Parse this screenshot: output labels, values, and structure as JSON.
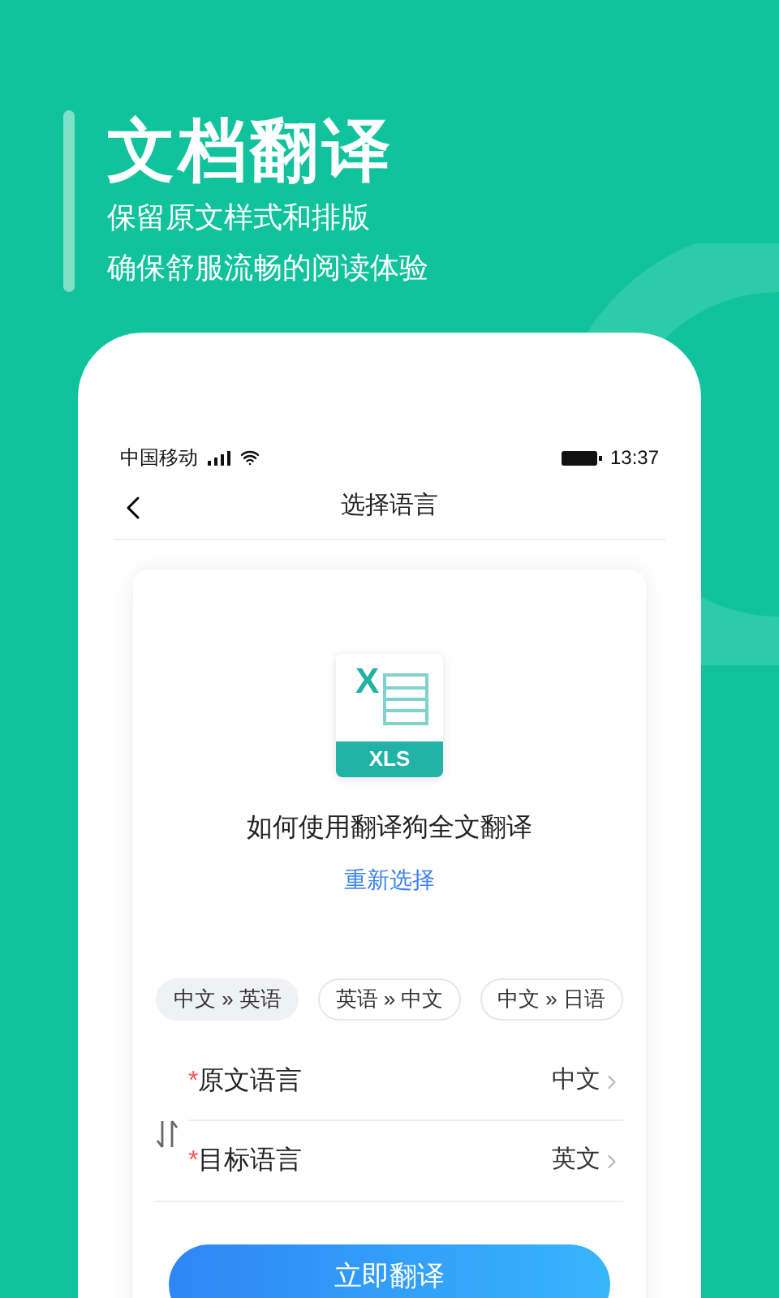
{
  "promo": {
    "title": "文档翻译",
    "lines": [
      "保留原文样式和排版",
      "确保舒服流畅的阅读体验"
    ]
  },
  "status_bar": {
    "carrier": "中国移动",
    "time": "13:37"
  },
  "nav": {
    "title": "选择语言"
  },
  "file": {
    "mark": "X",
    "label": "XLS",
    "name": "如何使用翻译狗全文翻译",
    "reselect": "重新选择"
  },
  "presets": [
    {
      "label": "中文 » 英语",
      "selected": true
    },
    {
      "label": "英语 » 中文",
      "selected": false
    },
    {
      "label": "中文 » 日语",
      "selected": false
    }
  ],
  "languages": [
    {
      "required_mark": "*",
      "label": "原文语言",
      "value": "中文"
    },
    {
      "required_mark": "*",
      "label": "目标语言",
      "value": "英文"
    }
  ],
  "translate_button": "立即翻译"
}
